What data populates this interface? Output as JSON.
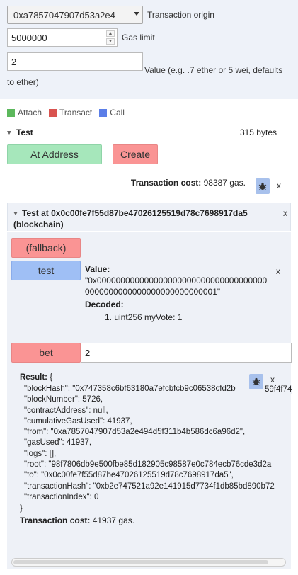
{
  "form": {
    "origin_value": "0xa7857047907d53a2e4",
    "origin_label": "Transaction origin",
    "gas_value": "5000000",
    "gas_label": "Gas limit",
    "value_value": "2",
    "value_label": "Value (e.g. .7 ether or 5 wei, defaults to ether)"
  },
  "legend": {
    "attach": "Attach",
    "transact": "Transact",
    "call": "Call",
    "colors": {
      "attach": "#5cb85c",
      "transact": "#d9534f",
      "call": "#5b7ee8"
    }
  },
  "contract": {
    "name": "Test",
    "size": "315 bytes",
    "at_address_label": "At Address",
    "create_label": "Create",
    "tx_cost_label": "Transaction cost:",
    "tx_cost_value": "98387 gas."
  },
  "instance": {
    "title": "Test at 0x0c00fe7f55d87be47026125519d78c7698917da5 (blockchain)",
    "fallback_label": "(fallback)",
    "test_label": "test",
    "value_label": "Value:",
    "value_hex_1": "\"0x000000000000000000000000000000000000",
    "value_hex_2": "0000000000000000000000000001\"",
    "decoded_label": "Decoded:",
    "decoded_item": "1. uint256 myVote: 1",
    "bet_label": "bet",
    "bet_value": "2"
  },
  "result": {
    "label": "Result:",
    "open": "{",
    "lines": [
      "\"blockHash\": \"0x747358c6bf63180a7efcbfcb9c06538cfd2b",
      "\"blockNumber\": 5726,",
      "\"contractAddress\": null,",
      "\"cumulativeGasUsed\": 41937,",
      "\"from\": \"0xa7857047907d53a2e494d5f311b4b586dc6a96d2\",",
      "\"gasUsed\": 41937,",
      "\"logs\": [],",
      "\"root\": \"98f7806db9e500fbe85d182905c98587e0c784ecb76cde3d2a",
      "\"to\": \"0x0c00fe7f55d87be47026125519d78c7698917da5\",",
      "\"transactionHash\": \"0xb2e747521a92e141915d7734f1db85bd890b72",
      "\"transactionIndex\": 0"
    ],
    "close": "}",
    "blockhash_tail": "59f4f74",
    "tx_cost_label": "Transaction cost:",
    "tx_cost_value": "41937 gas."
  },
  "close_x": "x"
}
